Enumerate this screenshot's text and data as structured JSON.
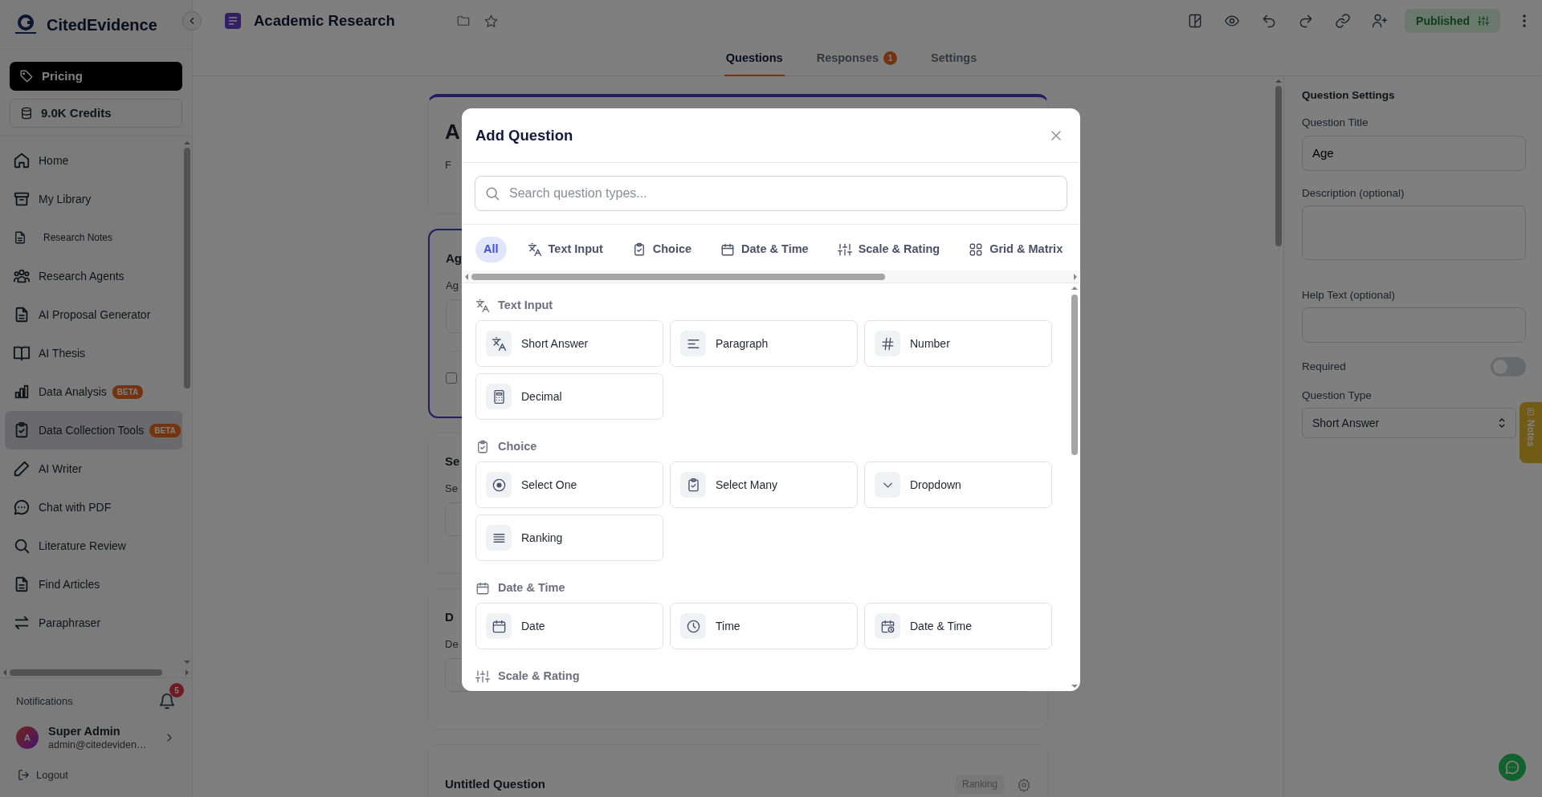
{
  "sidebar": {
    "brand": "CitedEvidence",
    "pricing": "Pricing",
    "credits": "9.0K Credits",
    "items": [
      {
        "label": "Home",
        "kind": "home",
        "selected": false
      },
      {
        "label": "My Library",
        "kind": "library",
        "selected": false
      },
      {
        "label": "Research Notes",
        "kind": "note",
        "selected": false
      },
      {
        "label": "Research Agents",
        "kind": "agents",
        "selected": false
      },
      {
        "label": "AI Proposal Generator",
        "kind": "file",
        "selected": false
      },
      {
        "label": "AI Thesis",
        "kind": "book",
        "selected": false
      },
      {
        "label": "Data Analysis",
        "kind": "chart",
        "badge": "BETA",
        "selected": false
      },
      {
        "label": "Data Collection Tools",
        "kind": "clipboard",
        "badge": "BETA",
        "selected": true
      },
      {
        "label": "AI Writer",
        "kind": "pen",
        "selected": false
      },
      {
        "label": "Chat with PDF",
        "kind": "chat",
        "selected": false
      },
      {
        "label": "Literature Review",
        "kind": "search",
        "selected": false
      },
      {
        "label": "Find Articles",
        "kind": "file",
        "selected": false
      },
      {
        "label": "Paraphraser",
        "kind": "swap",
        "selected": false
      }
    ],
    "notifications": {
      "label": "Notifications",
      "count": "5"
    },
    "user": {
      "initial": "A",
      "name": "Super Admin",
      "email": "admin@citedeviden…"
    },
    "logout": "Logout"
  },
  "header": {
    "title": "Academic Research",
    "status": "Published"
  },
  "tabs": [
    {
      "label": "Questions",
      "selected": true
    },
    {
      "label": "Responses",
      "badge": "1",
      "selected": false
    },
    {
      "label": "Settings",
      "selected": false
    }
  ],
  "form_cards": [
    {
      "kind": "header",
      "title": "A",
      "subtitle": "F"
    },
    {
      "kind": "question",
      "title": "Ag",
      "label": "Ag",
      "selected": true
    },
    {
      "kind": "question",
      "title": "Se",
      "label": "Se",
      "selected": false
    },
    {
      "kind": "question",
      "title": "D",
      "label": "De",
      "selected": false
    },
    {
      "kind": "footer",
      "title": "Untitled Question",
      "badge": "Ranking"
    }
  ],
  "settings": {
    "title": "Question Settings",
    "question_title_label": "Question Title",
    "question_title": "Age",
    "description_label": "Description (optional)",
    "help_label": "Help Text (optional)",
    "required_label": "Required",
    "required": false,
    "type_label": "Question Type",
    "type": "Short Answer"
  },
  "notes_tab": "Notes",
  "modal": {
    "title": "Add Question",
    "search_placeholder": "Search question types...",
    "filters": [
      {
        "label": "All",
        "kind": "none",
        "selected": true
      },
      {
        "label": "Text Input",
        "kind": "translate",
        "selected": false
      },
      {
        "label": "Choice",
        "kind": "clipboard",
        "selected": false
      },
      {
        "label": "Date & Time",
        "kind": "calendar",
        "selected": false
      },
      {
        "label": "Scale & Rating",
        "kind": "sliders",
        "selected": false
      },
      {
        "label": "Grid & Matrix",
        "kind": "grid",
        "selected": false
      }
    ],
    "sections": [
      {
        "title": "Text Input",
        "kind": "translate",
        "options": [
          {
            "label": "Short Answer",
            "kind": "translate"
          },
          {
            "label": "Paragraph",
            "kind": "paragraph"
          },
          {
            "label": "Number",
            "kind": "hash"
          },
          {
            "label": "Decimal",
            "kind": "calculator"
          }
        ]
      },
      {
        "title": "Choice",
        "kind": "clipboard",
        "options": [
          {
            "label": "Select One",
            "kind": "radio"
          },
          {
            "label": "Select Many",
            "kind": "clipboard"
          },
          {
            "label": "Dropdown",
            "kind": "chevron"
          },
          {
            "label": "Ranking",
            "kind": "list"
          }
        ]
      },
      {
        "title": "Date & Time",
        "kind": "calendar",
        "options": [
          {
            "label": "Date",
            "kind": "calendar"
          },
          {
            "label": "Time",
            "kind": "clock"
          },
          {
            "label": "Date & Time",
            "kind": "calclock"
          }
        ]
      },
      {
        "title": "Scale & Rating",
        "kind": "sliders"
      }
    ]
  }
}
